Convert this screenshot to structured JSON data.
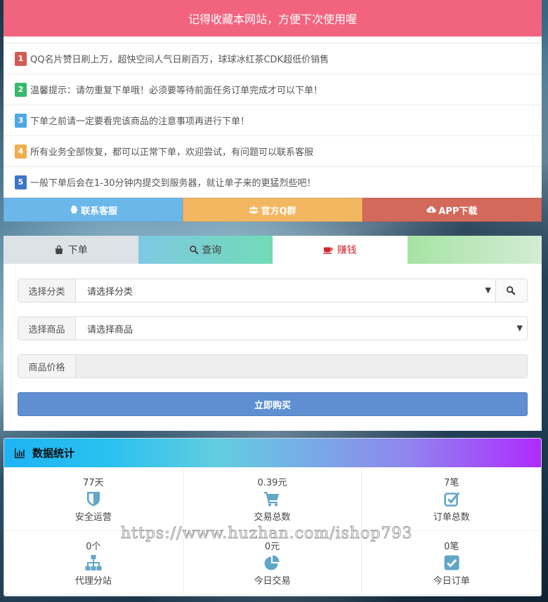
{
  "notice": {
    "header": "记得收藏本网站，方便下次使用喔",
    "items": [
      {
        "num": "1",
        "text": "QQ名片赞日刷上万，超快空间人气日刷百万，球球冰红茶CDK超低价销售"
      },
      {
        "num": "2",
        "text": "温馨提示：请勿重复下单哦！必须要等待前面任务订单完成才可以下单！"
      },
      {
        "num": "3",
        "text": "下单之前请一定要看完该商品的注意事项再进行下单！"
      },
      {
        "num": "4",
        "text": "所有业务全部恢复，都可以正常下单，欢迎尝试，有问题可以联系客服"
      },
      {
        "num": "5",
        "text": "一般下单后会在1-30分钟内提交到服务器，就让单子来的更猛烈些吧！"
      }
    ],
    "buttons": {
      "contact": "联系客服",
      "qq_group": "官方Q群",
      "app_download": "APP下载"
    }
  },
  "tabs": {
    "order": "下单",
    "query": "查询",
    "earn": "赚钱"
  },
  "form": {
    "category_label": "选择分类",
    "category_value": "请选择分类",
    "product_label": "选择商品",
    "product_value": "请选择商品",
    "price_label": "商品价格",
    "price_value": "",
    "buy_button": "立即购买",
    "caret": "▼"
  },
  "stats": {
    "title": "数据统计",
    "cells": [
      {
        "value": "77天",
        "label": "安全运营",
        "icon": "shield-icon"
      },
      {
        "value": "0.39元",
        "label": "交易总数",
        "icon": "cart-icon"
      },
      {
        "value": "7笔",
        "label": "订单总数",
        "icon": "checkbox-icon"
      },
      {
        "value": "0个",
        "label": "代理分站",
        "icon": "sitemap-icon"
      },
      {
        "value": "0元",
        "label": "今日交易",
        "icon": "pie-chart-icon"
      },
      {
        "value": "0笔",
        "label": "今日订单",
        "icon": "check-square-icon"
      }
    ],
    "icon_color": "#62a6c7"
  },
  "watermark": "https://www.huzhan.com/ishop793"
}
